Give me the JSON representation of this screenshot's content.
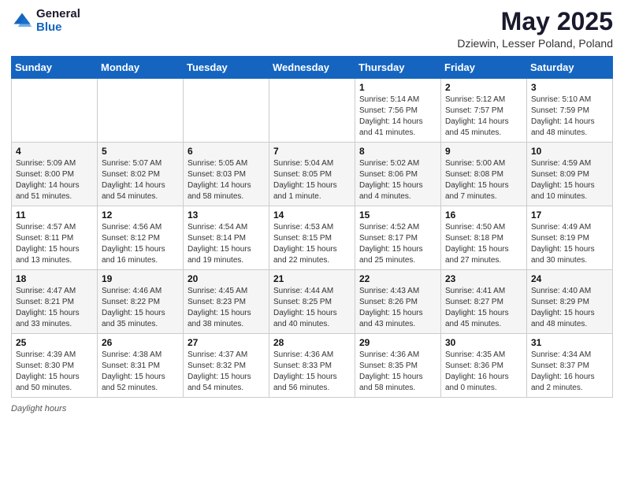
{
  "logo": {
    "general": "General",
    "blue": "Blue"
  },
  "title": {
    "month": "May 2025",
    "location": "Dziewin, Lesser Poland, Poland"
  },
  "weekdays": [
    "Sunday",
    "Monday",
    "Tuesday",
    "Wednesday",
    "Thursday",
    "Friday",
    "Saturday"
  ],
  "weeks": [
    [
      {
        "day": "",
        "info": ""
      },
      {
        "day": "",
        "info": ""
      },
      {
        "day": "",
        "info": ""
      },
      {
        "day": "",
        "info": ""
      },
      {
        "day": "1",
        "info": "Sunrise: 5:14 AM\nSunset: 7:56 PM\nDaylight: 14 hours and 41 minutes."
      },
      {
        "day": "2",
        "info": "Sunrise: 5:12 AM\nSunset: 7:57 PM\nDaylight: 14 hours and 45 minutes."
      },
      {
        "day": "3",
        "info": "Sunrise: 5:10 AM\nSunset: 7:59 PM\nDaylight: 14 hours and 48 minutes."
      }
    ],
    [
      {
        "day": "4",
        "info": "Sunrise: 5:09 AM\nSunset: 8:00 PM\nDaylight: 14 hours and 51 minutes."
      },
      {
        "day": "5",
        "info": "Sunrise: 5:07 AM\nSunset: 8:02 PM\nDaylight: 14 hours and 54 minutes."
      },
      {
        "day": "6",
        "info": "Sunrise: 5:05 AM\nSunset: 8:03 PM\nDaylight: 14 hours and 58 minutes."
      },
      {
        "day": "7",
        "info": "Sunrise: 5:04 AM\nSunset: 8:05 PM\nDaylight: 15 hours and 1 minute."
      },
      {
        "day": "8",
        "info": "Sunrise: 5:02 AM\nSunset: 8:06 PM\nDaylight: 15 hours and 4 minutes."
      },
      {
        "day": "9",
        "info": "Sunrise: 5:00 AM\nSunset: 8:08 PM\nDaylight: 15 hours and 7 minutes."
      },
      {
        "day": "10",
        "info": "Sunrise: 4:59 AM\nSunset: 8:09 PM\nDaylight: 15 hours and 10 minutes."
      }
    ],
    [
      {
        "day": "11",
        "info": "Sunrise: 4:57 AM\nSunset: 8:11 PM\nDaylight: 15 hours and 13 minutes."
      },
      {
        "day": "12",
        "info": "Sunrise: 4:56 AM\nSunset: 8:12 PM\nDaylight: 15 hours and 16 minutes."
      },
      {
        "day": "13",
        "info": "Sunrise: 4:54 AM\nSunset: 8:14 PM\nDaylight: 15 hours and 19 minutes."
      },
      {
        "day": "14",
        "info": "Sunrise: 4:53 AM\nSunset: 8:15 PM\nDaylight: 15 hours and 22 minutes."
      },
      {
        "day": "15",
        "info": "Sunrise: 4:52 AM\nSunset: 8:17 PM\nDaylight: 15 hours and 25 minutes."
      },
      {
        "day": "16",
        "info": "Sunrise: 4:50 AM\nSunset: 8:18 PM\nDaylight: 15 hours and 27 minutes."
      },
      {
        "day": "17",
        "info": "Sunrise: 4:49 AM\nSunset: 8:19 PM\nDaylight: 15 hours and 30 minutes."
      }
    ],
    [
      {
        "day": "18",
        "info": "Sunrise: 4:47 AM\nSunset: 8:21 PM\nDaylight: 15 hours and 33 minutes."
      },
      {
        "day": "19",
        "info": "Sunrise: 4:46 AM\nSunset: 8:22 PM\nDaylight: 15 hours and 35 minutes."
      },
      {
        "day": "20",
        "info": "Sunrise: 4:45 AM\nSunset: 8:23 PM\nDaylight: 15 hours and 38 minutes."
      },
      {
        "day": "21",
        "info": "Sunrise: 4:44 AM\nSunset: 8:25 PM\nDaylight: 15 hours and 40 minutes."
      },
      {
        "day": "22",
        "info": "Sunrise: 4:43 AM\nSunset: 8:26 PM\nDaylight: 15 hours and 43 minutes."
      },
      {
        "day": "23",
        "info": "Sunrise: 4:41 AM\nSunset: 8:27 PM\nDaylight: 15 hours and 45 minutes."
      },
      {
        "day": "24",
        "info": "Sunrise: 4:40 AM\nSunset: 8:29 PM\nDaylight: 15 hours and 48 minutes."
      }
    ],
    [
      {
        "day": "25",
        "info": "Sunrise: 4:39 AM\nSunset: 8:30 PM\nDaylight: 15 hours and 50 minutes."
      },
      {
        "day": "26",
        "info": "Sunrise: 4:38 AM\nSunset: 8:31 PM\nDaylight: 15 hours and 52 minutes."
      },
      {
        "day": "27",
        "info": "Sunrise: 4:37 AM\nSunset: 8:32 PM\nDaylight: 15 hours and 54 minutes."
      },
      {
        "day": "28",
        "info": "Sunrise: 4:36 AM\nSunset: 8:33 PM\nDaylight: 15 hours and 56 minutes."
      },
      {
        "day": "29",
        "info": "Sunrise: 4:36 AM\nSunset: 8:35 PM\nDaylight: 15 hours and 58 minutes."
      },
      {
        "day": "30",
        "info": "Sunrise: 4:35 AM\nSunset: 8:36 PM\nDaylight: 16 hours and 0 minutes."
      },
      {
        "day": "31",
        "info": "Sunrise: 4:34 AM\nSunset: 8:37 PM\nDaylight: 16 hours and 2 minutes."
      }
    ]
  ],
  "footer": {
    "label": "Daylight hours"
  }
}
